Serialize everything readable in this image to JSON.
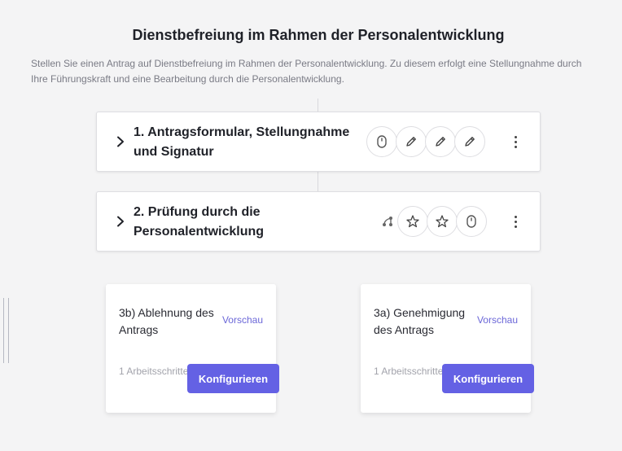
{
  "header": {
    "title": "Dienstbefreiung im Rahmen der Personalentwicklung",
    "description": "Stellen Sie einen Antrag auf Dienstbefreiung im Rahmen der Personalentwicklung. Zu diesem erfolgt eine Stellungnahme durch Ihre Führungskraft und eine Bearbeitung durch die Personalentwicklung."
  },
  "steps": [
    {
      "title": "1. Antragsformular, Stellungnahme und Signatur",
      "icons": [
        "mouse-icon",
        "pencil-icon",
        "pencil-icon",
        "pencil-icon"
      ]
    },
    {
      "title": "2. Prüfung durch die Personalentwicklung",
      "icons": [
        "branch-icon",
        "star-icon",
        "star-icon",
        "mouse-icon"
      ]
    }
  ],
  "outcomes": [
    {
      "title": "3b) Ablehnung des Antrags",
      "preview_label": "Vorschau",
      "steps_count": "1 Arbeitsschritte",
      "configure_label": "Konfigurieren"
    },
    {
      "title": "3a) Genehmigung des Antrags",
      "preview_label": "Vorschau",
      "steps_count": "1 Arbeitsschritte",
      "configure_label": "Konfigurieren"
    }
  ],
  "colors": {
    "accent": "#6461e4",
    "link": "#6b67d8",
    "background": "#f4f4f5"
  }
}
